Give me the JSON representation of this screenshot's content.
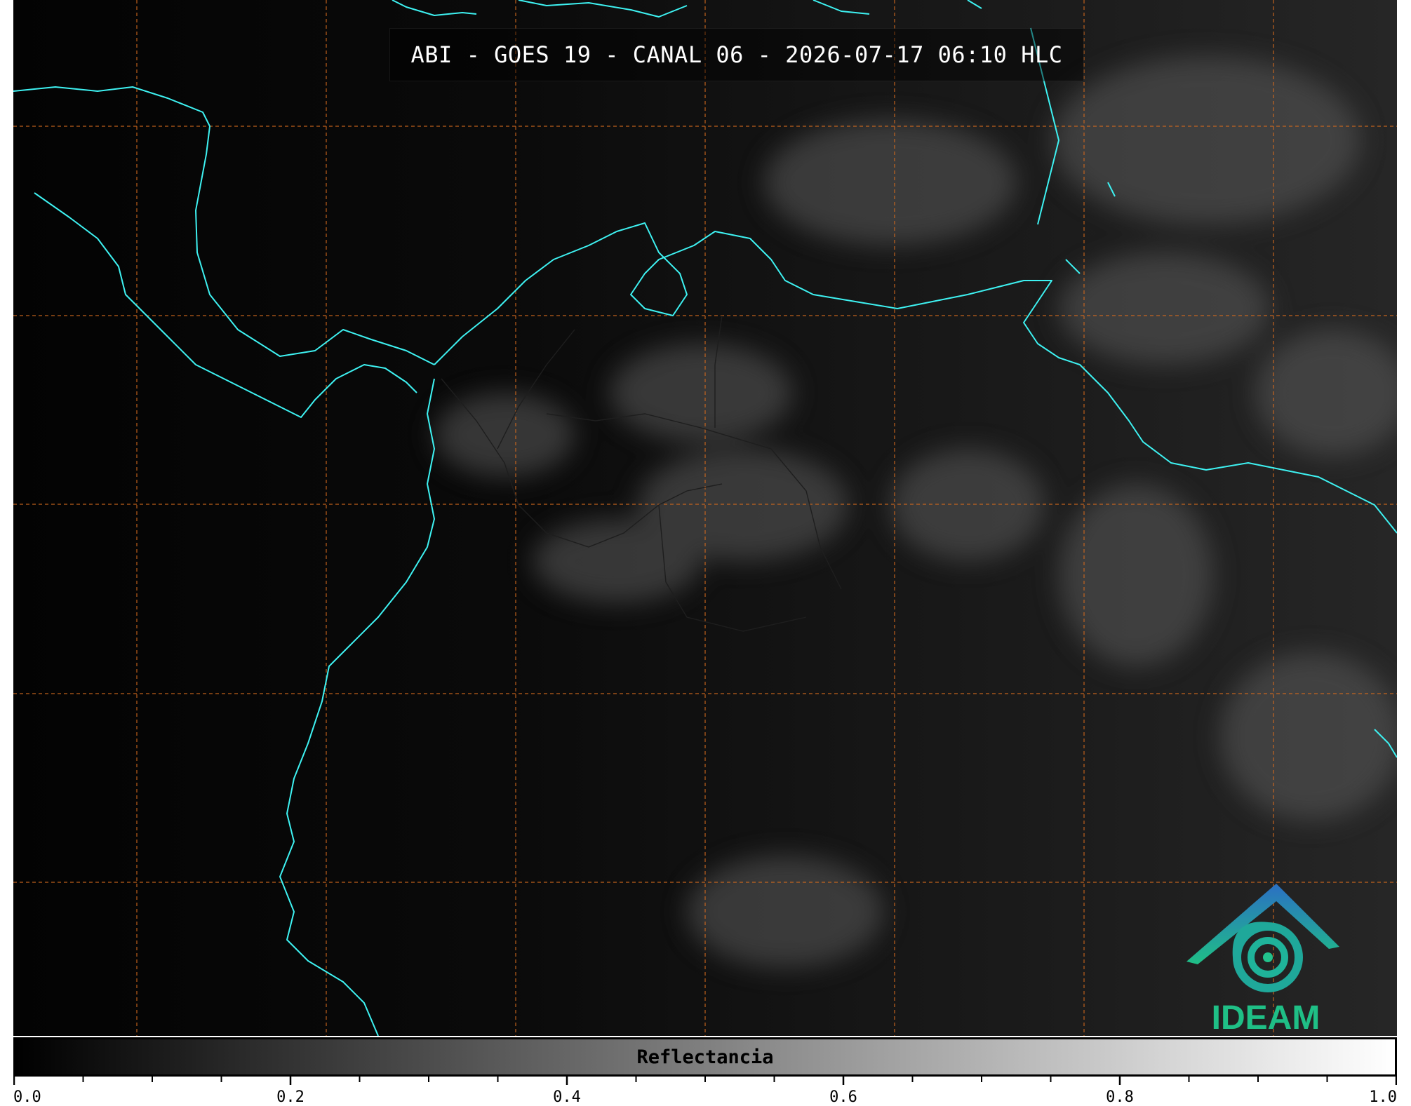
{
  "title": "ABI - GOES 19 - CANAL 06 - 2026-07-17 06:10 HLC",
  "logo": {
    "text": "IDEAM",
    "icon": "ideam-logo-icon"
  },
  "colorbar": {
    "label": "Reflectancia",
    "min": 0.0,
    "max": 1.0,
    "major_ticks": [
      "0.0",
      "0.2",
      "0.4",
      "0.6",
      "0.8",
      "1.0"
    ],
    "minor_step": 0.05,
    "colors": {
      "low": "#000000",
      "high": "#ffffff"
    }
  },
  "colors": {
    "coastline": "#3ef2f2",
    "graticule": "#d2691e",
    "background": "#050505"
  }
}
